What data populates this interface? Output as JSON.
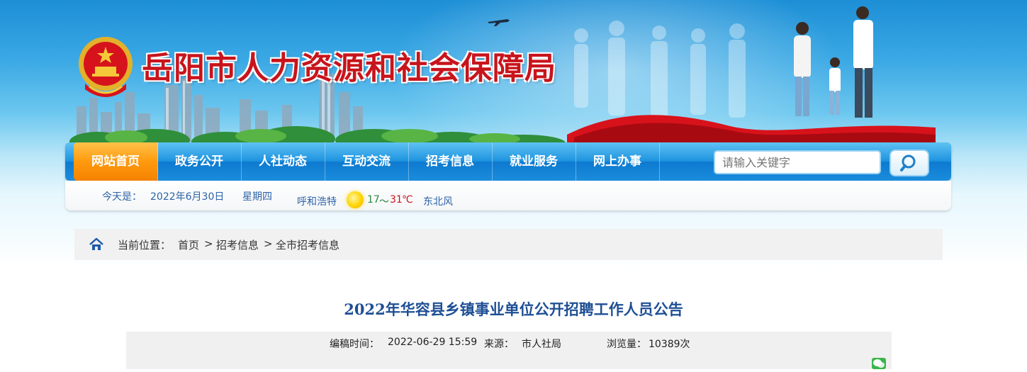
{
  "header": {
    "site_title": "岳阳市人力资源和社会保障局",
    "emblem_icon": "national-emblem-icon",
    "colors": {
      "title_red": "#c8141c",
      "sky_blue": "#1d8fd6"
    }
  },
  "nav": {
    "items": [
      {
        "label": "网站首页",
        "active": true
      },
      {
        "label": "政务公开",
        "active": false
      },
      {
        "label": "人社动态",
        "active": false
      },
      {
        "label": "互动交流",
        "active": false
      },
      {
        "label": "招考信息",
        "active": false
      },
      {
        "label": "就业服务",
        "active": false
      },
      {
        "label": "网上办事",
        "active": false
      }
    ],
    "search": {
      "placeholder": "请输入关键字",
      "button_icon": "search-icon"
    },
    "colors": {
      "bar": "#1f94e0",
      "active": "#ff9a0e"
    }
  },
  "info_bar": {
    "today_label": "今天是：",
    "date": "2022年6月30日",
    "weekday": "星期四",
    "city": "呼和浩特",
    "weather_icon": "sun-icon",
    "temp_low": "17",
    "temp_sep": "～",
    "temp_high": "31",
    "temp_unit": "℃",
    "wind": "东北风"
  },
  "breadcrumb": {
    "home_icon": "home-icon",
    "label": "当前位置：",
    "items": [
      "首页",
      "招考信息",
      "全市招考信息"
    ],
    "separator": ">"
  },
  "article": {
    "title": "2022年华容县乡镇事业单位公开招聘工作人员公告",
    "edit_time_label": "编稿时间：",
    "edit_time": "2022-06-29 15:59",
    "source_label": "来源：",
    "source": "市人社局",
    "views_label": "浏览量：",
    "views": "10389次",
    "share_icon": "wechat-icon"
  }
}
